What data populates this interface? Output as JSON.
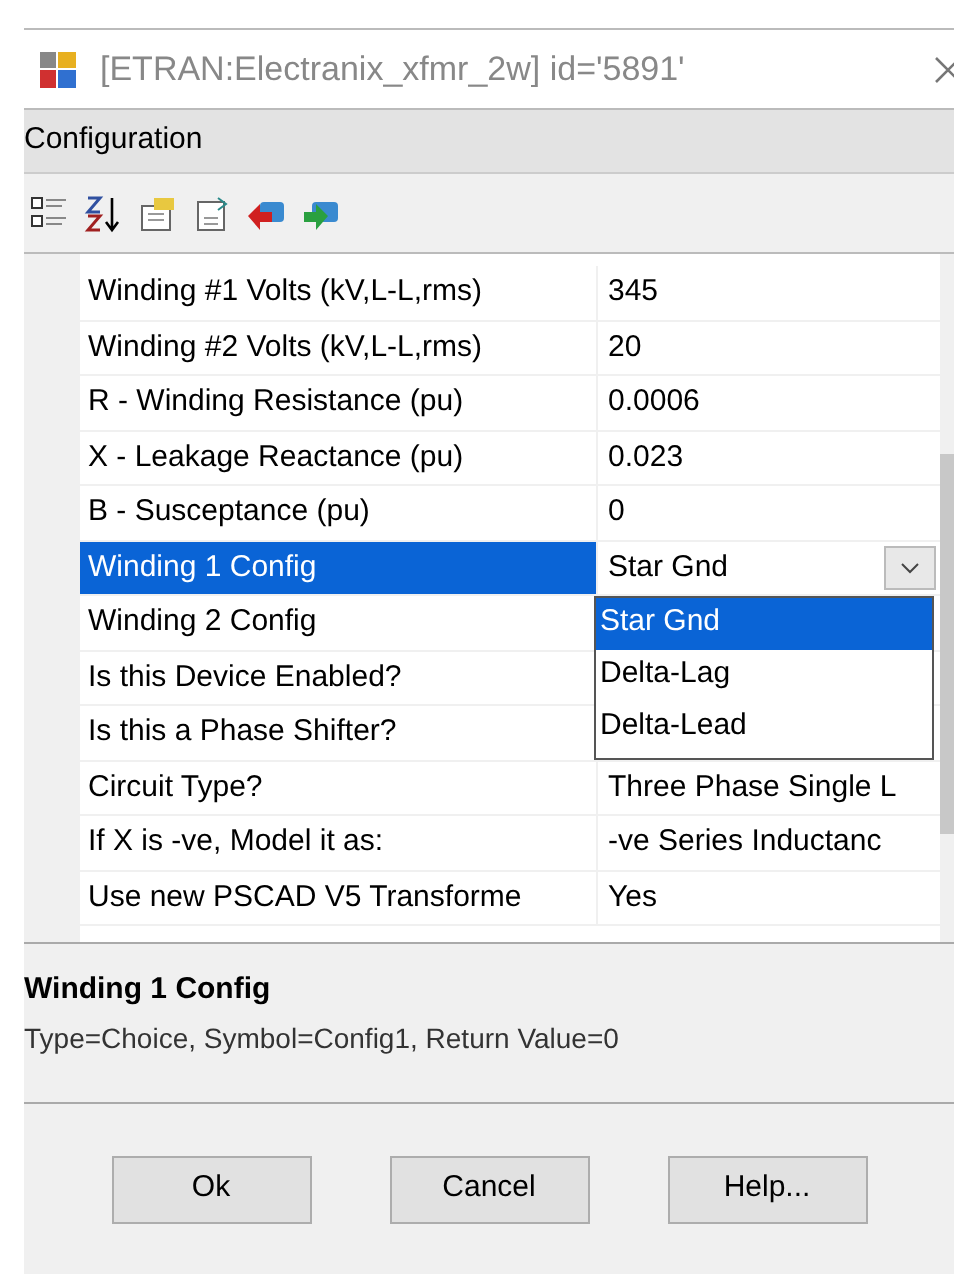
{
  "window": {
    "title": "[ETRAN:Electranix_xfmr_2w] id='5891'"
  },
  "panel": {
    "title": "Configuration"
  },
  "properties": [
    {
      "name": "Winding #1 Volts (kV,L-L,rms)",
      "value": "345",
      "selected": false
    },
    {
      "name": "Winding #2 Volts (kV,L-L,rms)",
      "value": "20",
      "selected": false
    },
    {
      "name": "R - Winding Resistance (pu)",
      "value": "0.0006",
      "selected": false
    },
    {
      "name": "X - Leakage Reactance (pu)",
      "value": "0.023",
      "selected": false
    },
    {
      "name": "B - Susceptance (pu)",
      "value": "0",
      "selected": false
    },
    {
      "name": "Winding 1 Config",
      "value": "Star Gnd",
      "selected": true
    },
    {
      "name": "Winding 2 Config",
      "selected": false
    },
    {
      "name": "Is this Device Enabled?",
      "selected": false
    },
    {
      "name": "Is this a Phase Shifter?",
      "selected": false
    },
    {
      "name": "Circuit Type?",
      "value": "Three Phase Single L",
      "selected": false
    },
    {
      "name": "If X is -ve, Model it as:",
      "value": "-ve Series Inductanc",
      "selected": false
    },
    {
      "name": "Use new PSCAD V5 Transforme",
      "value": "Yes",
      "selected": false
    }
  ],
  "dropdown": {
    "options": [
      {
        "label": "Star Gnd",
        "selected": true
      },
      {
        "label": "Delta-Lag",
        "selected": false
      },
      {
        "label": "Delta-Lead",
        "selected": false
      }
    ]
  },
  "description": {
    "title": "Winding 1 Config",
    "text": "Type=Choice, Symbol=Config1, Return Value=0"
  },
  "buttons": [
    "Ok",
    "Cancel",
    "Help..."
  ]
}
